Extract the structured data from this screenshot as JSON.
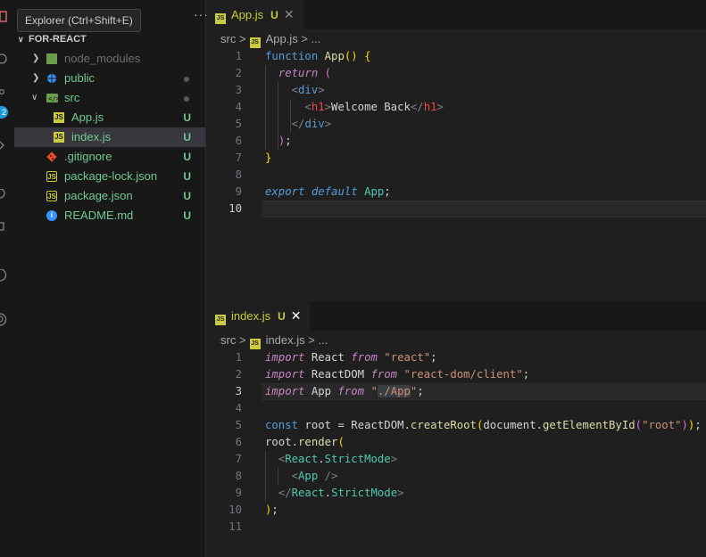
{
  "tooltip": "Explorer (Ctrl+Shift+E)",
  "activity_badge": "2",
  "explorer": {
    "more_label": "···",
    "folder_name": "FOR-REACT",
    "items": [
      {
        "label": "node_modules",
        "icon": "folder-node-icon",
        "status": ""
      },
      {
        "label": "public",
        "icon": "folder-public-icon",
        "status": ""
      },
      {
        "label": "src",
        "icon": "folder-src-icon",
        "status": ""
      },
      {
        "label": "App.js",
        "icon": "js-file-icon",
        "status": "U"
      },
      {
        "label": "index.js",
        "icon": "js-file-icon",
        "status": "U"
      },
      {
        "label": ".gitignore",
        "icon": "git-file-icon",
        "status": "U"
      },
      {
        "label": "package-lock.json",
        "icon": "json-file-icon",
        "status": "U"
      },
      {
        "label": "package.json",
        "icon": "json-file-icon",
        "status": "U"
      },
      {
        "label": "README.md",
        "icon": "info-file-icon",
        "status": "U"
      }
    ]
  },
  "editor_top": {
    "tab": {
      "icon_text": "JS",
      "label": "App.js",
      "status": "U",
      "close": "✕"
    },
    "breadcrumb": {
      "folder": "src",
      "sep": ">",
      "file": "App.js",
      "sep2": ">",
      "more": "..."
    },
    "line_numbers": [
      "1",
      "2",
      "3",
      "4",
      "5",
      "6",
      "7",
      "8",
      "9",
      "10"
    ]
  },
  "editor_bottom": {
    "tab": {
      "icon_text": "JS",
      "label": "index.js",
      "status": "U",
      "close": "✕"
    },
    "breadcrumb": {
      "folder": "src",
      "sep": ">",
      "file": "index.js",
      "sep2": ">",
      "more": "..."
    },
    "line_numbers": [
      "1",
      "2",
      "3",
      "4",
      "5",
      "6",
      "7",
      "8",
      "9",
      "10",
      "11"
    ]
  },
  "colors": {
    "accent": "#cbcb41",
    "background": "#1f1f1f",
    "sidebar": "#181818",
    "untracked": "#73c991"
  }
}
